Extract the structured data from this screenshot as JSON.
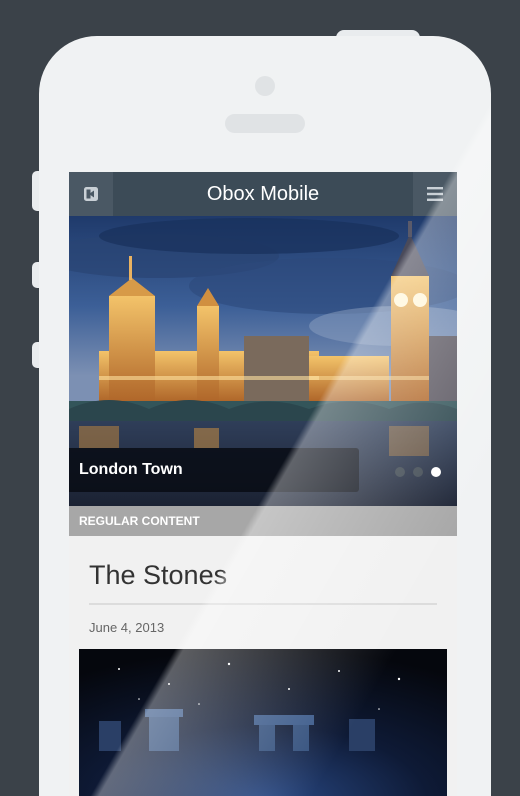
{
  "app": {
    "title": "Obox Mobile"
  },
  "nav": {
    "left_icon": "sign-in-icon",
    "right_icon": "hamburger-menu-icon"
  },
  "slider": {
    "caption": "London Town",
    "slide_count": 3,
    "active_slide": 3
  },
  "section": {
    "label": "REGULAR CONTENT"
  },
  "post": {
    "title": "The Stones",
    "date": "June 4, 2013"
  },
  "colors": {
    "background": "#3b4249",
    "nav_bar": "#3c4b57",
    "section_bar": "#a7a7a7",
    "caption_bg": "#080c14"
  }
}
